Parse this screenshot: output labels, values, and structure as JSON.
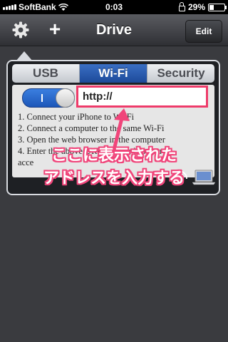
{
  "status_bar": {
    "carrier": "SoftBank",
    "time": "0:03",
    "battery": "29%",
    "battery_level": 0.29
  },
  "nav": {
    "title": "Drive",
    "edit_label": "Edit",
    "add_label": "+"
  },
  "tabs": [
    {
      "label": "USB",
      "active": false
    },
    {
      "label": "Wi-Fi",
      "active": true
    },
    {
      "label": "Security",
      "active": false
    }
  ],
  "wifi": {
    "url_prefix": "http://",
    "toggle_on": true,
    "instructions": [
      "1. Connect your iPhone to Wi-Fi",
      "2. Connect a computer to the same Wi-Fi",
      "3. Open the web browser in the computer",
      "4. Enter the above URL into the browser to",
      "acce"
    ]
  },
  "annotation": {
    "line1": "ここに表示された",
    "line2": "アドレスを入力する",
    "color": "#f0457a"
  },
  "colors": {
    "accent": "#2c63c0",
    "highlight": "#ee3b6a"
  }
}
